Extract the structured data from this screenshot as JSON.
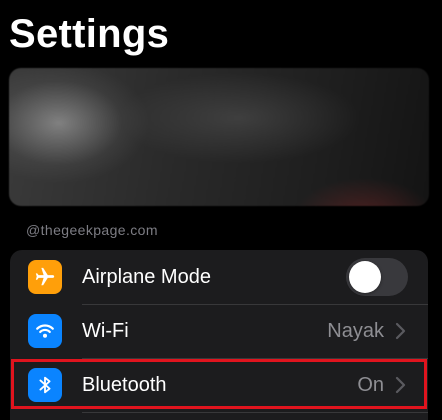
{
  "page": {
    "title": "Settings"
  },
  "watermark": {
    "text": "@thegeekpage.com"
  },
  "settings": {
    "rows": [
      {
        "label": "Airplane Mode",
        "icon": "airplane-icon",
        "icon_color": "#ff9f0a",
        "control": "toggle",
        "toggle_on": false
      },
      {
        "label": "Wi-Fi",
        "icon": "wifi-icon",
        "icon_color": "#0a84ff",
        "value": "Nayak",
        "control": "chevron"
      },
      {
        "label": "Bluetooth",
        "icon": "bluetooth-icon",
        "icon_color": "#0a84ff",
        "value": "On",
        "control": "chevron",
        "highlighted": true
      }
    ]
  },
  "colors": {
    "background": "#000000",
    "group_background": "#1c1c1e",
    "secondary_text": "#8e8e93",
    "highlight": "#e0141e",
    "toggle_off": "#39393d"
  }
}
